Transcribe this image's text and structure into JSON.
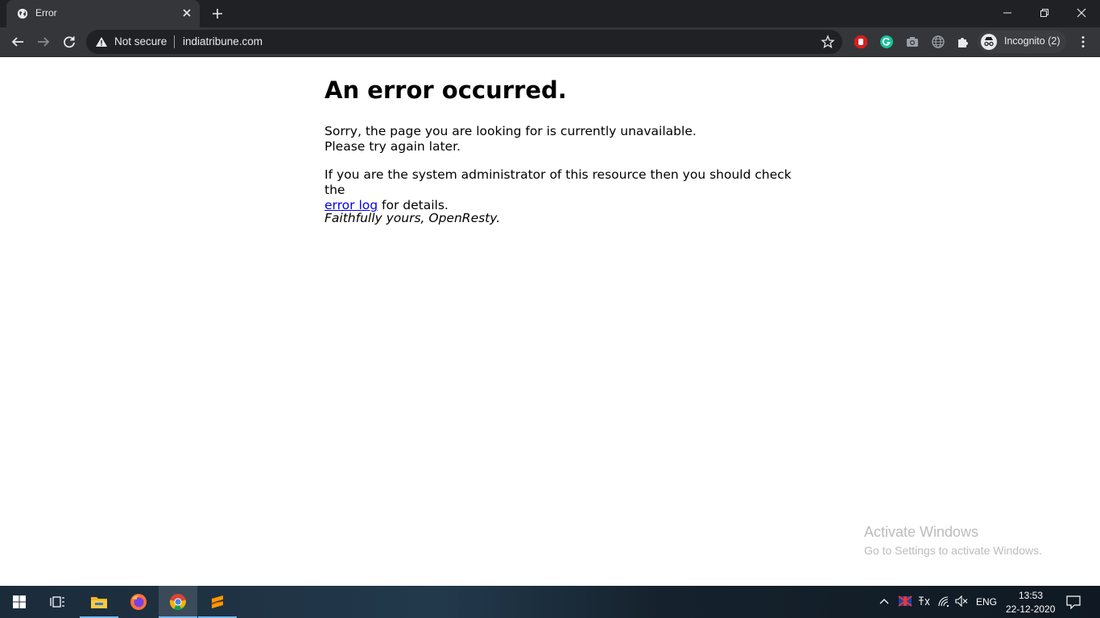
{
  "browser": {
    "tab_title": "Error",
    "security_label": "Not secure",
    "url": "indiatribune.com",
    "profile_label": "Incognito (2)"
  },
  "page": {
    "heading": "An error occurred.",
    "para1_line1": "Sorry, the page you are looking for is currently unavailable.",
    "para1_line2": "Please try again later.",
    "para2_text": "If you are the system administrator of this resource then you should check the",
    "para2_link": "error log",
    "para2_tail": "for details.",
    "signature": "Faithfully yours, OpenResty."
  },
  "watermark": {
    "line1": "Activate Windows",
    "line2": "Go to Settings to activate Windows."
  },
  "taskbar": {
    "apps": [
      "start-icon",
      "task-view-icon",
      "file-explorer-icon",
      "firefox-icon",
      "chrome-icon",
      "sublime-text-icon"
    ],
    "language": "ENG",
    "time": "13:53",
    "date": "22-12-2020"
  },
  "colors": {
    "chrome_frame": "#202124",
    "toolbar": "#35363a",
    "link": "#0000ee"
  }
}
